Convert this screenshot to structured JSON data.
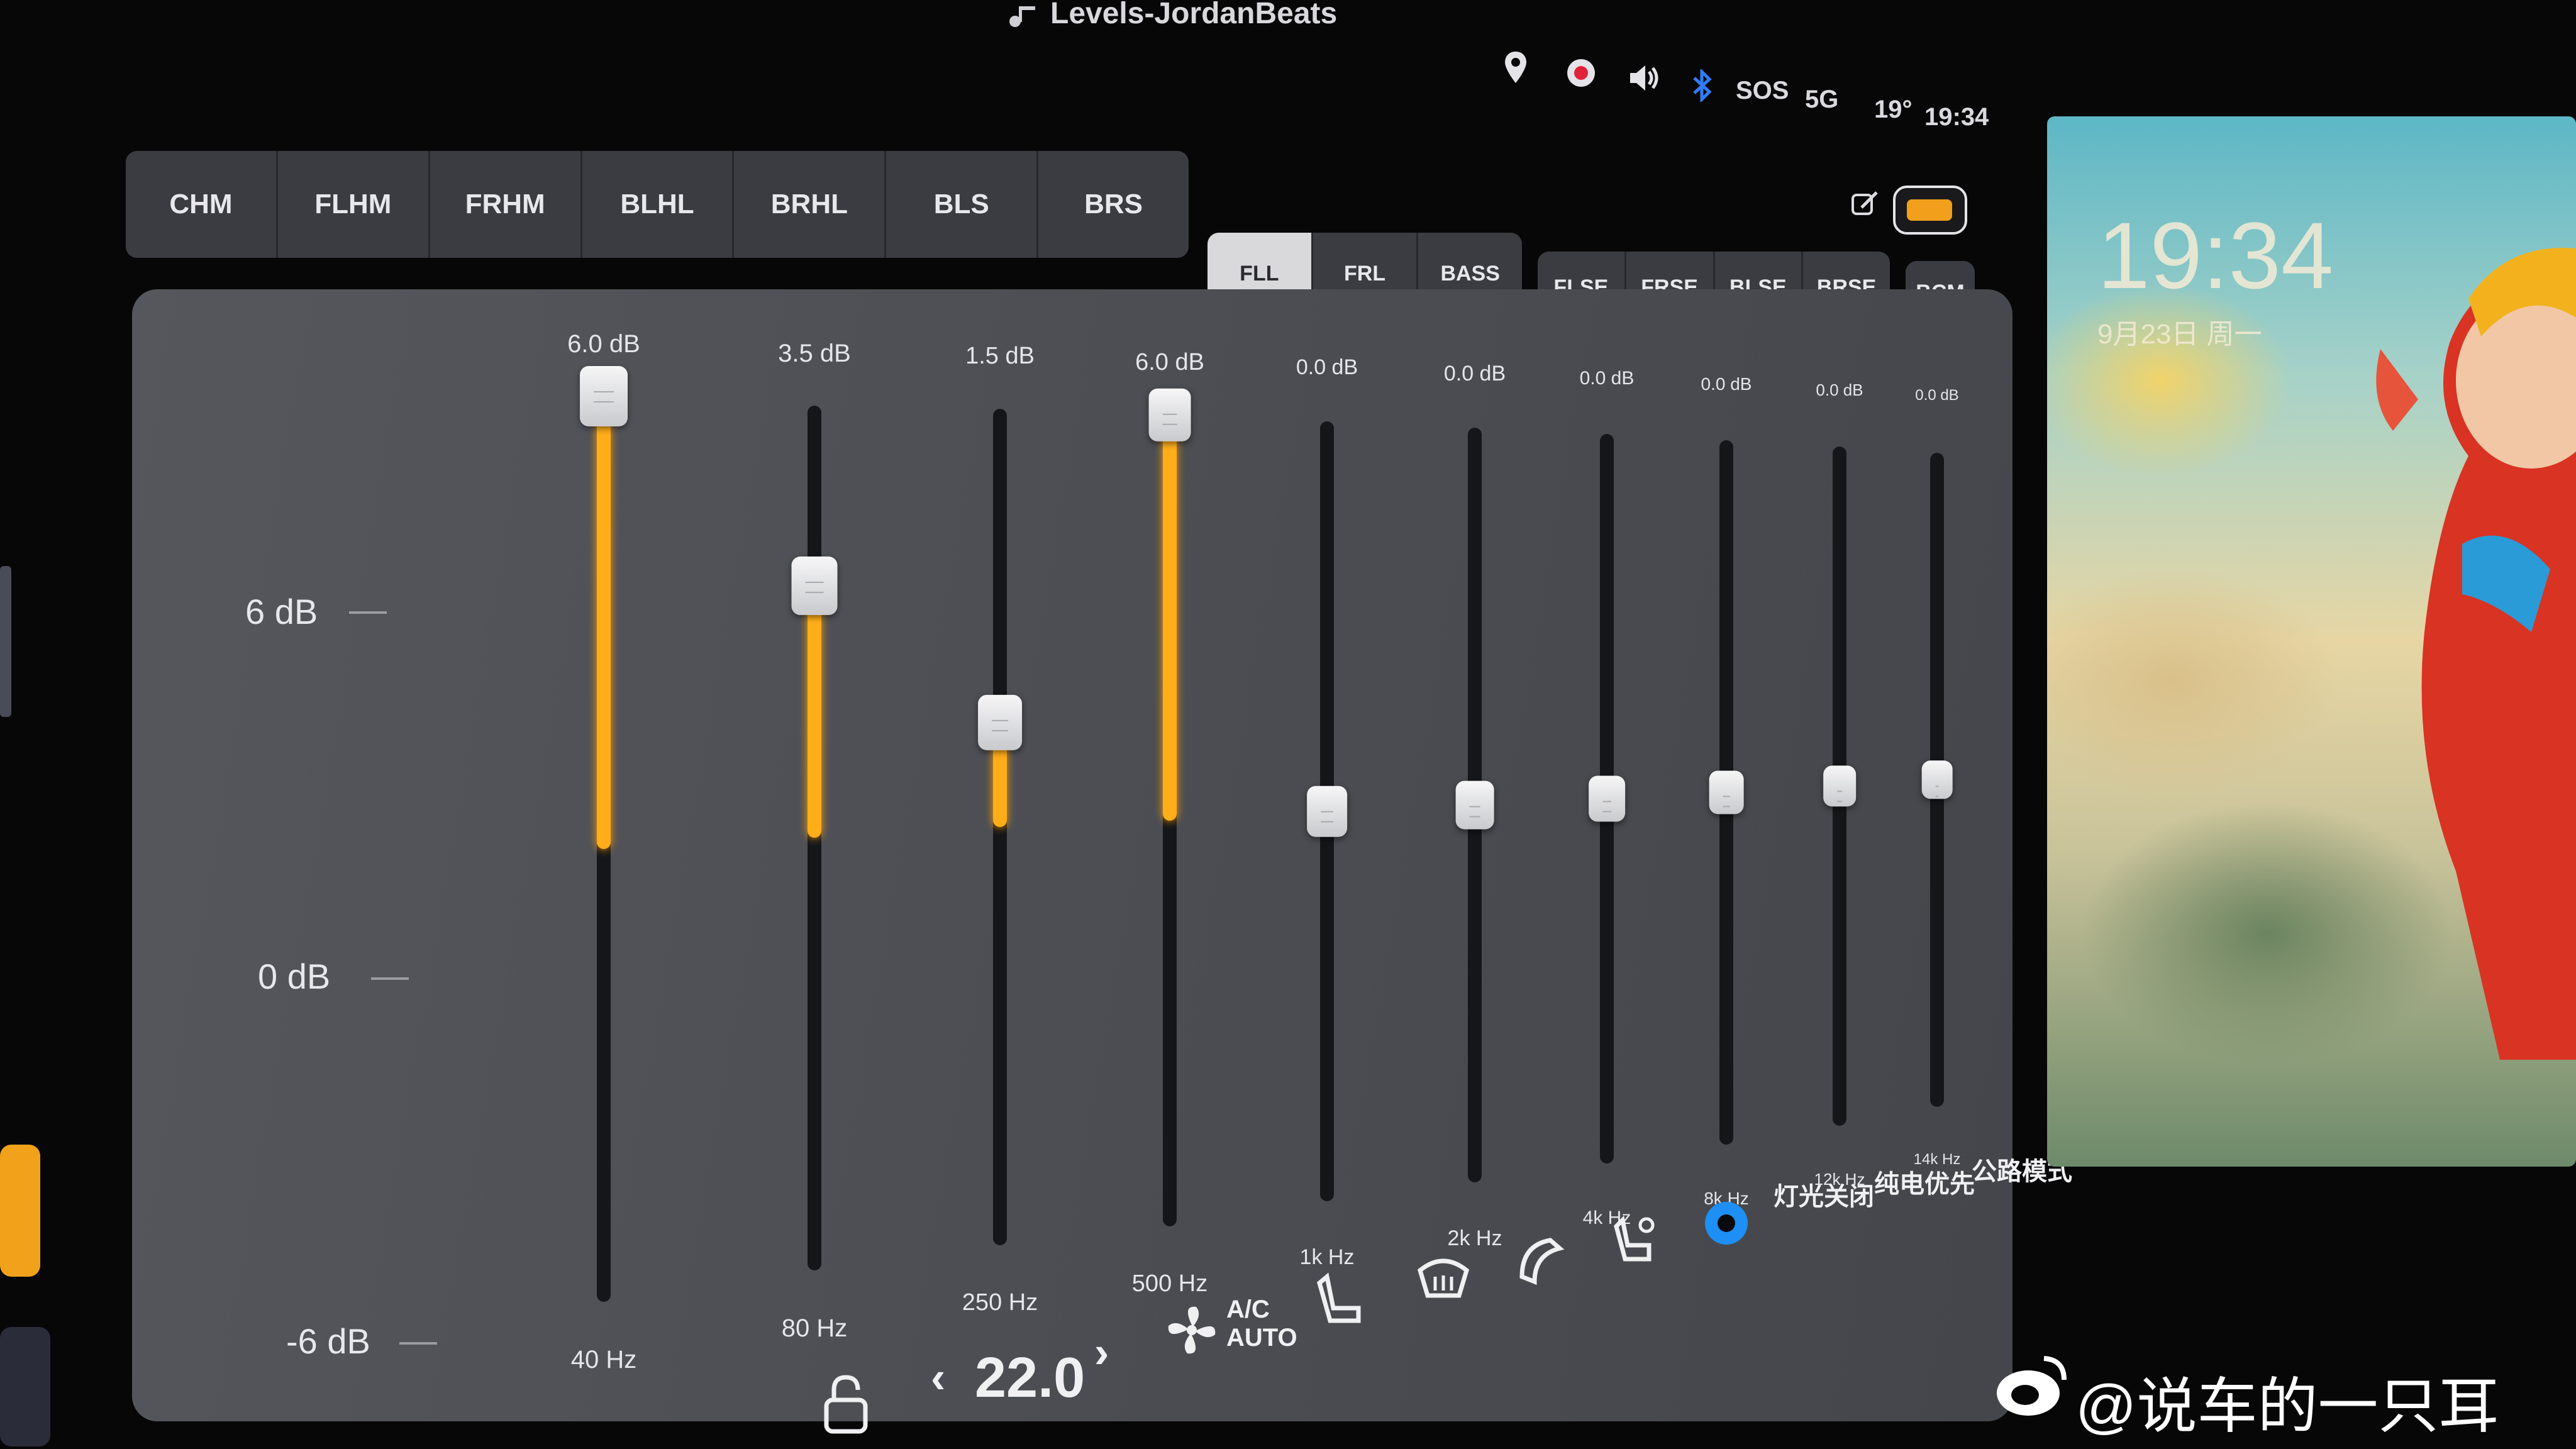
{
  "now_playing": {
    "title": "Levels-JordanBeats"
  },
  "status_bar": {
    "sos": "SOS",
    "signal": "5G",
    "temperature": "19°",
    "time": "19:34"
  },
  "speaker_tabs": {
    "group1": [
      "CHM",
      "FLHM",
      "FRHM",
      "BLHL",
      "BRHL",
      "BLS",
      "BRS"
    ],
    "group2": [
      "FLL",
      "FRL",
      "BASS"
    ],
    "group3": [
      "FLSE",
      "FRSE",
      "BLSE",
      "BRSE"
    ],
    "group4": [
      "BCM"
    ],
    "active": "FLL"
  },
  "db_scale": [
    "6 dB",
    "0 dB",
    "-6 dB"
  ],
  "equalizer": {
    "range_db": [
      -6,
      6
    ],
    "bands": [
      {
        "freq": "40 Hz",
        "value_label": "6.0 dB",
        "gain_db": 6.0
      },
      {
        "freq": "80 Hz",
        "value_label": "3.5 dB",
        "gain_db": 3.5
      },
      {
        "freq": "250 Hz",
        "value_label": "1.5 dB",
        "gain_db": 1.5
      },
      {
        "freq": "500 Hz",
        "value_label": "6.0 dB",
        "gain_db": 6.0
      },
      {
        "freq": "1k Hz",
        "value_label": "0.0 dB",
        "gain_db": 0.0
      },
      {
        "freq": "2k Hz",
        "value_label": "0.0 dB",
        "gain_db": 0.0
      },
      {
        "freq": "4k Hz",
        "value_label": "0.0 dB",
        "gain_db": 0.0
      },
      {
        "freq": "8k Hz",
        "value_label": "0.0 dB",
        "gain_db": 0.0
      },
      {
        "freq": "12k Hz",
        "value_label": "0.0 dB",
        "gain_db": 0.0
      },
      {
        "freq": "14k Hz",
        "value_label": "0.0 dB",
        "gain_db": 0.0
      }
    ],
    "accent_color": "#ffae1a"
  },
  "bottom_bar": {
    "temperature": "22.0",
    "ac_label": "A/C",
    "auto_label": "AUTO",
    "lights_off": "灯光关闭",
    "pure_electric": "纯电优先",
    "mode": "公路模式",
    "left_chevron": "‹",
    "right_chevron": "›"
  },
  "wallpaper": {
    "time": "19:34",
    "date": "9月23日 周一"
  },
  "watermark": "@说车的一只耳"
}
